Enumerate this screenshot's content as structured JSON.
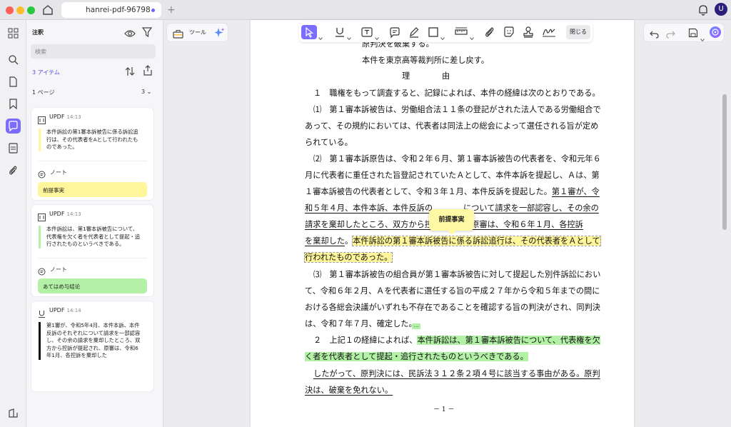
{
  "window": {
    "tab_title": "hanrei-pdf-96798"
  },
  "panel": {
    "title": "注釈",
    "search_placeholder": "検索",
    "count": "3 アイテム",
    "page_label": "1 ページ",
    "page_count": "3",
    "cards": [
      {
        "author": "UPDF",
        "time": "14:13",
        "quote": [
          "本件訴訟の第1審本訴被告に係る訴訟追",
          "行は、その代表者をAとして行われたも",
          "のであった。"
        ],
        "note_label": "ノート",
        "note": "前提事実",
        "color": "#fff59a"
      },
      {
        "author": "UPDF",
        "time": "14:13",
        "quote": [
          "本件訴訟は、第1審本訴被告について、",
          "代表権を欠く者を代表者として提起・追",
          "行されたものというべきである。"
        ],
        "note_label": "ノート",
        "note": "あてはめ与结论",
        "color": "#b2f1a6"
      },
      {
        "author": "UPDF",
        "time": "14:14",
        "quote": [
          "第1審が、令和5年4月、本件本訴、本件",
          "反訴のそれぞれについて請求を一部認容",
          "し、その余の請求を棄却したところ、双",
          "方から控訴が提起され、原審は、令和6",
          "年1月、各控訴を棄却した"
        ],
        "color": "#111111"
      }
    ]
  },
  "toolbar": {
    "tools_label": "ツール",
    "close_label": "閉じる"
  },
  "document": {
    "tooltip": "前提事実",
    "page_number": "－ 1 －",
    "lines": {
      "l1": "原判決を破棄する。",
      "l2": "本件を東京高等裁判所に差し戻す。",
      "l3": "理　　　　由",
      "l4": "１　職権をもって調査すると、記録によれば、本件の経緯は次のとおりである。",
      "l5": "⑴　第１審本訴被告は、労働組合法１１条の登記がされた法人である労働組合で",
      "l6": "あって、その規約においては、代表者は同法上の総会によって選任される旨が定め",
      "l7": "られている。",
      "l8": "⑵　第１審本訴原告は、令和２年６月、第１審本訴被告の代表者を、令和元年６",
      "l9": "月に代表者に重任された旨登記されていたＡとして、本件本訴を提起し、Ａは、第",
      "l10a": "１審本訴被告の代表者として、令和３年１月、本件反訴を提起した。",
      "l10b": "第１審が、令",
      "l11a": "和５年４月、本件本訴、本件反訴の",
      "l11b": "について請求を一部認容し、その余の",
      "l12a": "請求を棄却したところ、双方から控",
      "l12b": "、原審は、令和６年１月、各控訴",
      "l13a": "を棄却した",
      "l13b": "。",
      "l13c": "本件訴訟の第１審本訴被告に係る訴訟追行は、その代表者をＡとして",
      "l14": "行われたものであった。",
      "l15": "⑶　第１審本訴被告の組合員が第１審本訴被告に対して提起した別件訴訟におい",
      "l16": "て、令和６年２月、Ａを代表者に選任する旨の平成２７年から令和５年までの間に",
      "l17": "おける各総会決議がいずれも不存在であることを確認する旨の判決がされ、同判決",
      "l18": "は、令和７年７月、確定した。",
      "l19a": "２　上記１の経緯によれば、",
      "l19b": "本件訴訟は、第１審本訴被告について、代表権を欠",
      "l20": "く者を代表者として提起・追行されたものというべきである。",
      "l21": "したがって、原判決には、民訴法３１２条２項４号に該当する事由がある。原判",
      "l22": "決は、破棄を免れない。"
    }
  }
}
